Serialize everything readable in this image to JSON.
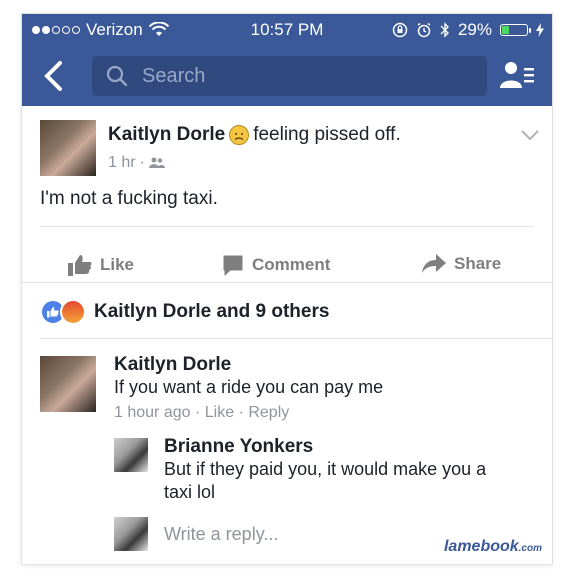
{
  "status_bar": {
    "carrier": "Verizon",
    "time": "10:57 PM",
    "battery": "29%",
    "battery_level": 0.29,
    "signal_bars_filled": 2,
    "signal_bars_total": 5
  },
  "nav": {
    "search_placeholder": "Search"
  },
  "post": {
    "author": "Kaitlyn Dorle",
    "feeling": "feeling pissed off.",
    "time": "1 hr",
    "privacy_separator": "·",
    "text": "I'm not a fucking taxi."
  },
  "actions": {
    "like": "Like",
    "comment": "Comment",
    "share": "Share"
  },
  "reactions": {
    "summary": "Kaitlyn Dorle and 9 others"
  },
  "comments": [
    {
      "author": "Kaitlyn Dorle",
      "text": "If you want a ride you can pay me",
      "time": "1 hour ago",
      "like": "Like",
      "reply": "Reply",
      "sep": "·"
    }
  ],
  "replies": [
    {
      "author": "Brianne Yonkers",
      "text_line1": "But if they paid you, it would make you a",
      "text_line2": "taxi lol"
    }
  ],
  "reply_input": {
    "placeholder": "Write a reply..."
  },
  "watermark": {
    "brand": "lamebook",
    "suffix": ".com"
  },
  "colors": {
    "facebook_blue": "#3b5998",
    "search_bg": "#30497e",
    "meta_gray": "#90949c"
  }
}
